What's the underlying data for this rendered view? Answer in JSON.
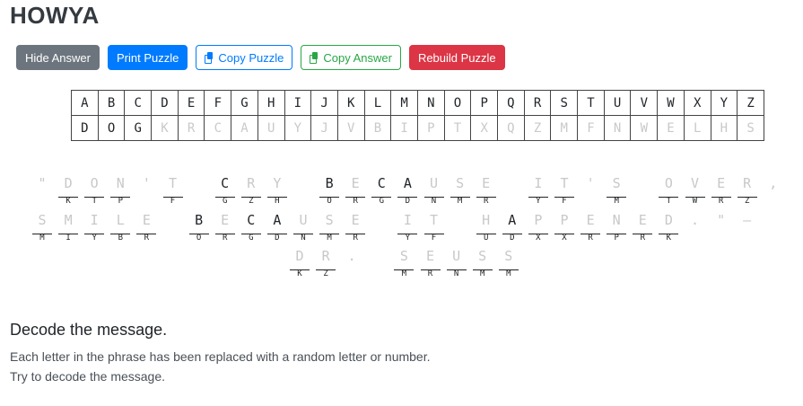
{
  "title": "HOWYA",
  "toolbar": {
    "hide_answer": "Hide Answer",
    "print_puzzle": "Print Puzzle",
    "copy_puzzle": "Copy Puzzle",
    "copy_answer": "Copy Answer",
    "rebuild_puzzle": "Rebuild Puzzle"
  },
  "key": {
    "plain": [
      "A",
      "B",
      "C",
      "D",
      "E",
      "F",
      "G",
      "H",
      "I",
      "J",
      "K",
      "L",
      "M",
      "N",
      "O",
      "P",
      "Q",
      "R",
      "S",
      "T",
      "U",
      "V",
      "W",
      "X",
      "Y",
      "Z"
    ],
    "cipher": [
      "D",
      "O",
      "G",
      "K",
      "R",
      "C",
      "A",
      "U",
      "Y",
      "J",
      "V",
      "B",
      "I",
      "P",
      "T",
      "X",
      "Q",
      "Z",
      "M",
      "F",
      "N",
      "W",
      "E",
      "L",
      "H",
      "S"
    ],
    "revealed_count": 3
  },
  "puzzle": {
    "lines": [
      [
        {
          "p": "\"",
          "c": ""
        },
        {
          "p": "D",
          "c": "K"
        },
        {
          "p": "O",
          "c": "T"
        },
        {
          "p": "N",
          "c": "P"
        },
        {
          "p": "'",
          "c": ""
        },
        {
          "p": "T",
          "c": "F"
        },
        {
          "p": " ",
          "c": ""
        },
        {
          "p": "C",
          "c": "G"
        },
        {
          "p": "R",
          "c": "Z"
        },
        {
          "p": "Y",
          "c": "H"
        },
        {
          "p": " ",
          "c": ""
        },
        {
          "p": "B",
          "c": "O"
        },
        {
          "p": "E",
          "c": "R"
        },
        {
          "p": "C",
          "c": "G"
        },
        {
          "p": "A",
          "c": "D"
        },
        {
          "p": "U",
          "c": "N"
        },
        {
          "p": "S",
          "c": "M"
        },
        {
          "p": "E",
          "c": "R"
        },
        {
          "p": " ",
          "c": ""
        },
        {
          "p": "I",
          "c": "Y"
        },
        {
          "p": "T",
          "c": "F"
        },
        {
          "p": "'",
          "c": ""
        },
        {
          "p": "S",
          "c": "M"
        },
        {
          "p": " ",
          "c": ""
        },
        {
          "p": "O",
          "c": "T"
        },
        {
          "p": "V",
          "c": "W"
        },
        {
          "p": "E",
          "c": "R"
        },
        {
          "p": "R",
          "c": "Z"
        },
        {
          "p": ",",
          "c": ""
        }
      ],
      [
        {
          "p": "S",
          "c": "M"
        },
        {
          "p": "M",
          "c": "I"
        },
        {
          "p": "I",
          "c": "Y"
        },
        {
          "p": "L",
          "c": "B"
        },
        {
          "p": "E",
          "c": "R"
        },
        {
          "p": " ",
          "c": ""
        },
        {
          "p": "B",
          "c": "O"
        },
        {
          "p": "E",
          "c": "R"
        },
        {
          "p": "C",
          "c": "G"
        },
        {
          "p": "A",
          "c": "D"
        },
        {
          "p": "U",
          "c": "N"
        },
        {
          "p": "S",
          "c": "M"
        },
        {
          "p": "E",
          "c": "R"
        },
        {
          "p": " ",
          "c": ""
        },
        {
          "p": "I",
          "c": "Y"
        },
        {
          "p": "T",
          "c": "F"
        },
        {
          "p": " ",
          "c": ""
        },
        {
          "p": "H",
          "c": "U"
        },
        {
          "p": "A",
          "c": "D"
        },
        {
          "p": "P",
          "c": "X"
        },
        {
          "p": "P",
          "c": "X"
        },
        {
          "p": "E",
          "c": "R"
        },
        {
          "p": "N",
          "c": "P"
        },
        {
          "p": "E",
          "c": "R"
        },
        {
          "p": "D",
          "c": "K"
        },
        {
          "p": ".",
          "c": ""
        },
        {
          "p": "\"",
          "c": ""
        },
        {
          "p": "—",
          "c": ""
        }
      ],
      [
        {
          "p": "D",
          "c": "K"
        },
        {
          "p": "R",
          "c": "Z"
        },
        {
          "p": ".",
          "c": ""
        },
        {
          "p": " ",
          "c": ""
        },
        {
          "p": "S",
          "c": "M"
        },
        {
          "p": "E",
          "c": "R"
        },
        {
          "p": "U",
          "c": "N"
        },
        {
          "p": "S",
          "c": "M"
        },
        {
          "p": "S",
          "c": "M"
        }
      ]
    ]
  },
  "instructions": {
    "heading": "Decode the message.",
    "line1": "Each letter in the phrase has been replaced with a random letter or number.",
    "line2": "Try to decode the message."
  },
  "colors": {
    "hide_answer": "#6c757d",
    "print_puzzle": "#007bff",
    "copy_puzzle": "#007bff",
    "copy_answer": "#28a745",
    "rebuild_puzzle": "#dc3545",
    "hint_letter": "#c8c8c8"
  }
}
